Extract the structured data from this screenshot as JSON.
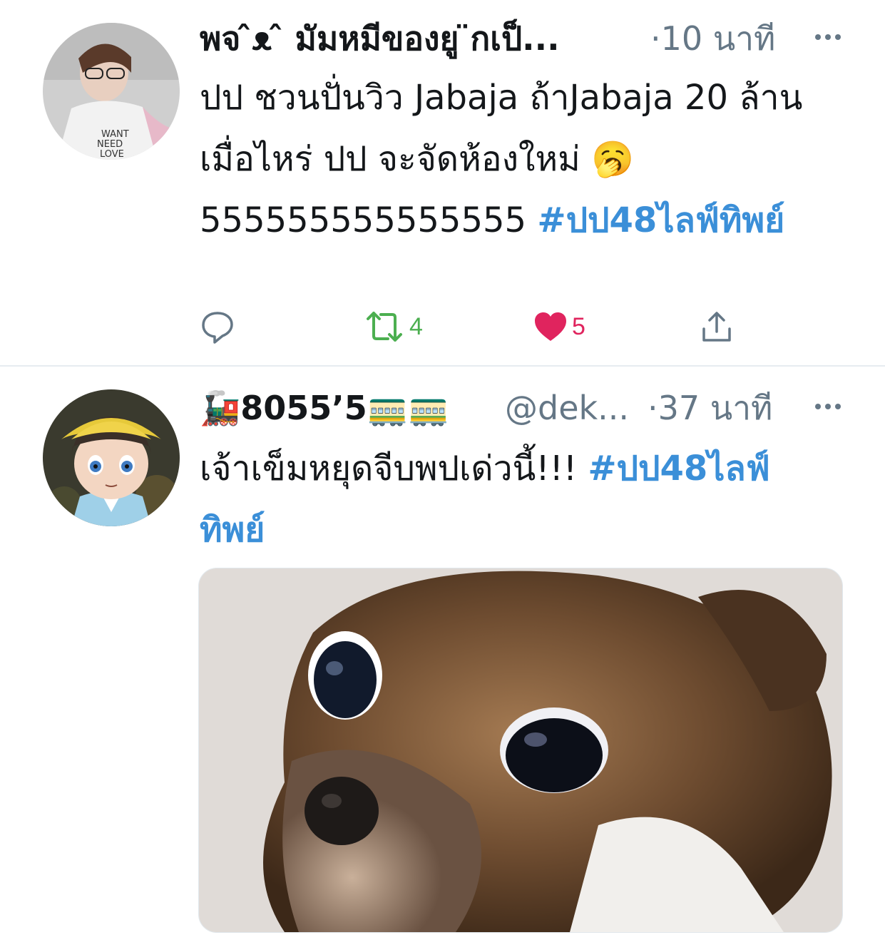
{
  "tweets": [
    {
      "display_name": "พจ ̂ᴥ ̂ มัมหมีของยู ̈กเป็...",
      "separator": "·",
      "time": "10 นาที",
      "text": "ปป ชวนปั่นวิว Jabaja ถ้าJabaja 20 ล้านเมื่อไหร่ ปป จะจัดห้องใหม่ 🥱 555555555555555",
      "hashtag": "#ปป48ไลฟ์ทิพย์",
      "actions": {
        "reply_icon": "reply-icon",
        "retweet_icon": "retweet-icon",
        "retweet_count": "4",
        "like_icon": "heart-icon",
        "like_count": "5",
        "share_icon": "share-icon"
      },
      "colors": {
        "retweet": "#4caf50",
        "like": "#e0245e"
      }
    },
    {
      "display_name": "🚂8055’5🚃🚃",
      "handle": "@dek...",
      "separator": "·",
      "time": "37 นาที",
      "text": "เจ้าเข็มหยุดจีบพปเด่วนี้!!!",
      "hashtag": "#ปป48ไลฟ์ทิพย์",
      "media": "photo of a chihuahua dog with wide eyes"
    }
  ],
  "colors": {
    "text": "#14171a",
    "secondary": "#657786",
    "hashtag": "#3b8fd8",
    "divider": "#e6ecf0"
  }
}
